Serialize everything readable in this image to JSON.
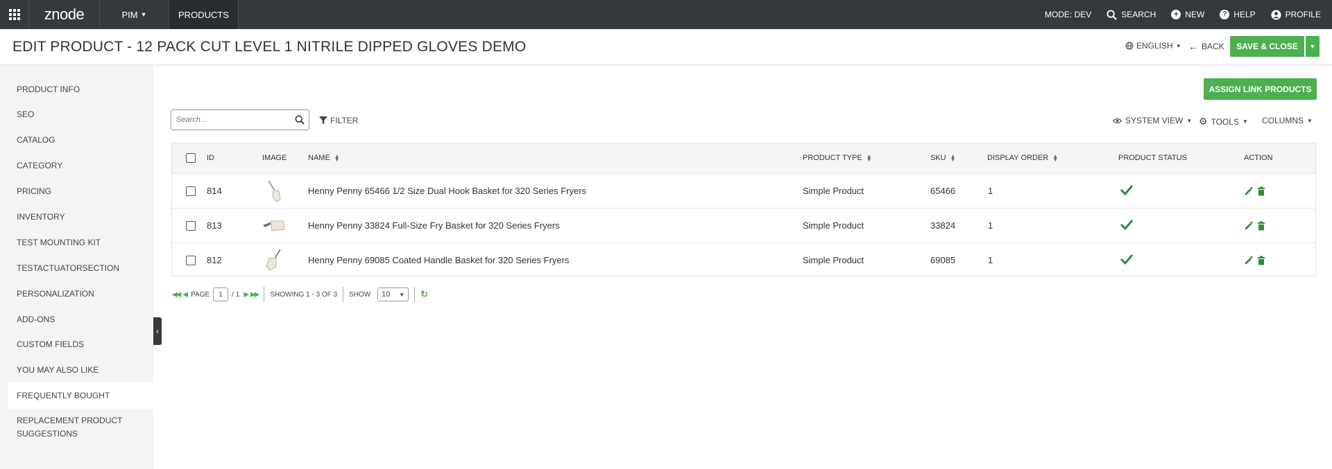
{
  "topnav": {
    "logo": "znode",
    "pim_label": "PIM",
    "products_label": "PRODUCTS",
    "mode": "MODE: DEV",
    "search_label": "SEARCH",
    "new_label": "NEW",
    "help_label": "HELP",
    "profile_label": "PROFILE"
  },
  "header": {
    "title": "EDIT PRODUCT  - 12 PACK CUT LEVEL 1 NITRILE DIPPED GLOVES DEMO",
    "language": "ENGLISH",
    "back_label": "BACK",
    "save_label": "SAVE & CLOSE"
  },
  "sidebar": {
    "items": [
      {
        "label": "PRODUCT INFO"
      },
      {
        "label": "SEO"
      },
      {
        "label": "CATALOG"
      },
      {
        "label": "CATEGORY"
      },
      {
        "label": "PRICING"
      },
      {
        "label": "INVENTORY"
      },
      {
        "label": "TEST MOUNTING KIT"
      },
      {
        "label": "TESTACTUATORSECTION"
      },
      {
        "label": "PERSONALIZATION"
      },
      {
        "label": "ADD-ONS"
      },
      {
        "label": "CUSTOM FIELDS"
      },
      {
        "label": "YOU MAY ALSO LIKE"
      },
      {
        "label": "FREQUENTLY BOUGHT"
      },
      {
        "label": "REPLACEMENT PRODUCT SUGGESTIONS"
      }
    ],
    "active_index": 12
  },
  "toolbar": {
    "assign_label": "ASSIGN LINK PRODUCTS",
    "search_placeholder": "Search...",
    "filter_label": "FILTER",
    "system_view_label": "SYSTEM VIEW",
    "tools_label": "TOOLS",
    "columns_label": "COLUMNS"
  },
  "table": {
    "headers": {
      "id": "ID",
      "image": "IMAGE",
      "name": "NAME",
      "product_type": "PRODUCT TYPE",
      "sku": "SKU",
      "display_order": "DISPLAY ORDER",
      "product_status": "PRODUCT STATUS",
      "action": "ACTION"
    },
    "rows": [
      {
        "id": "814",
        "name": "Henny Penny 65466 1/2 Size Dual Hook Basket for 320 Series Fryers",
        "product_type": "Simple Product",
        "sku": "65466",
        "display_order": "1",
        "status": "active"
      },
      {
        "id": "813",
        "name": "Henny Penny 33824 Full-Size Fry Basket for 320 Series Fryers",
        "product_type": "Simple Product",
        "sku": "33824",
        "display_order": "1",
        "status": "active"
      },
      {
        "id": "812",
        "name": "Henny Penny 69085 Coated Handle Basket for 320 Series Fryers",
        "product_type": "Simple Product",
        "sku": "69085",
        "display_order": "1",
        "status": "active"
      }
    ]
  },
  "pager": {
    "page_label": "PAGE",
    "page_value": "1",
    "page_total": "/ 1",
    "showing": "SHOWING 1 - 3 OF 3",
    "show_label": "SHOW",
    "page_size": "10"
  },
  "colors": {
    "accent": "#4caf50",
    "topnav_bg": "#35393c",
    "sidebar_bg": "#f4f4f4"
  }
}
